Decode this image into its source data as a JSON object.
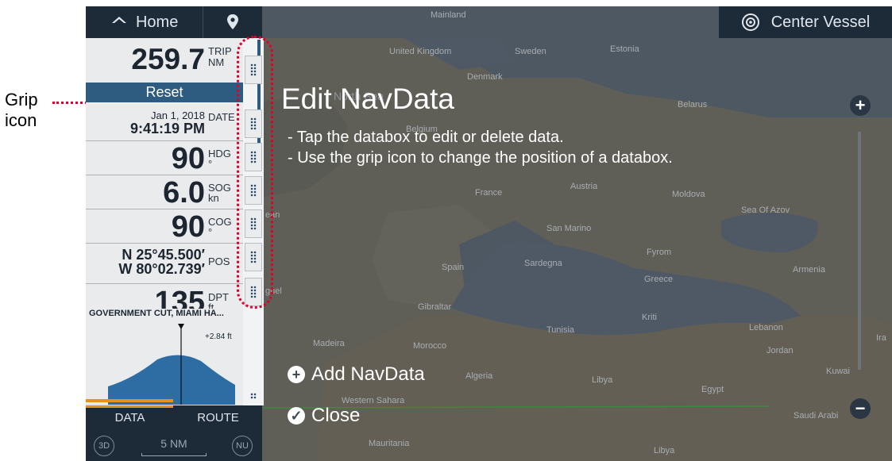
{
  "annotation": {
    "label": "Grip\nicon"
  },
  "topbar": {
    "home_label": "Home",
    "center_label": "Center Vessel"
  },
  "panel": {
    "trip": {
      "value": "259.7",
      "unit_top": "TRIP",
      "unit_bottom": "NM"
    },
    "reset_label": "Reset",
    "date": {
      "line1": "Jan 1, 2018",
      "line2": "9:41:19 PM",
      "unit": "DATE"
    },
    "hdg": {
      "value": "90",
      "unit_top": "HDG",
      "unit_bottom": "°"
    },
    "sog": {
      "value": "6.0",
      "unit_top": "SOG",
      "unit_bottom": "kn"
    },
    "cog": {
      "value": "90",
      "unit_top": "COG",
      "unit_bottom": "°"
    },
    "pos": {
      "lat": "N 25°45.500′",
      "lon": "W 80°02.739′",
      "unit": "POS"
    },
    "dpt": {
      "value": "135",
      "unit_top": "DPT",
      "unit_bottom": "ft"
    },
    "tide": {
      "station": "GOVERNMENT CUT, MIAMI HA...",
      "height": "+2.84 ft"
    }
  },
  "tabs": [
    {
      "label": "DATA",
      "active": true
    },
    {
      "label": "ROUTE",
      "active": false
    }
  ],
  "bottom": {
    "mode_3d": "3D",
    "scale": "5 NM",
    "north_up": "NU"
  },
  "overlay": {
    "title": "Edit NavData",
    "instructions": [
      "- Tap the databox to edit or delete data.",
      "- Use the grip icon to change the position of a databox."
    ],
    "add_label": "Add NavData",
    "close_label": "Close"
  },
  "map_labels": {
    "mainland": "Mainland",
    "uk": "United Kingdom",
    "sweden": "Sweden",
    "estonia": "Estonia",
    "denmark": "Denmark",
    "north_sea": "North Sea",
    "belarus": "Belarus",
    "belgium": "Belgium",
    "france": "France",
    "austria": "Austria",
    "moldova": "Moldova",
    "azov": "Sea Of Azov",
    "san_marino": "San Marino",
    "fyrom": "Fyrom",
    "spain": "Spain",
    "sardegna": "Sardegna",
    "greece": "Greece",
    "armenia": "Armenia",
    "gibraltar": "Gibraltar",
    "kriti": "Kriti",
    "tunisia": "Tunisia",
    "lebanon": "Lebanon",
    "madeira": "Madeira",
    "morocco": "Morocco",
    "jordan": "Jordan",
    "algeria": "Algeria",
    "libya": "Libya",
    "kuwait": "Kuwai",
    "egypt": "Egypt",
    "western_sahara": "Western Sahara",
    "saudi": "Saudi Arabi",
    "mauritania": "Mauritania",
    "libya2": "Libya",
    "ean": "ean",
    "guel": "guel",
    "ira": "Ira"
  },
  "colors": {
    "panel_dark": "#1d2a38",
    "reset_blue": "#2e5c80",
    "tab_accent": "#e8901c",
    "callout_red": "#e0002a"
  }
}
